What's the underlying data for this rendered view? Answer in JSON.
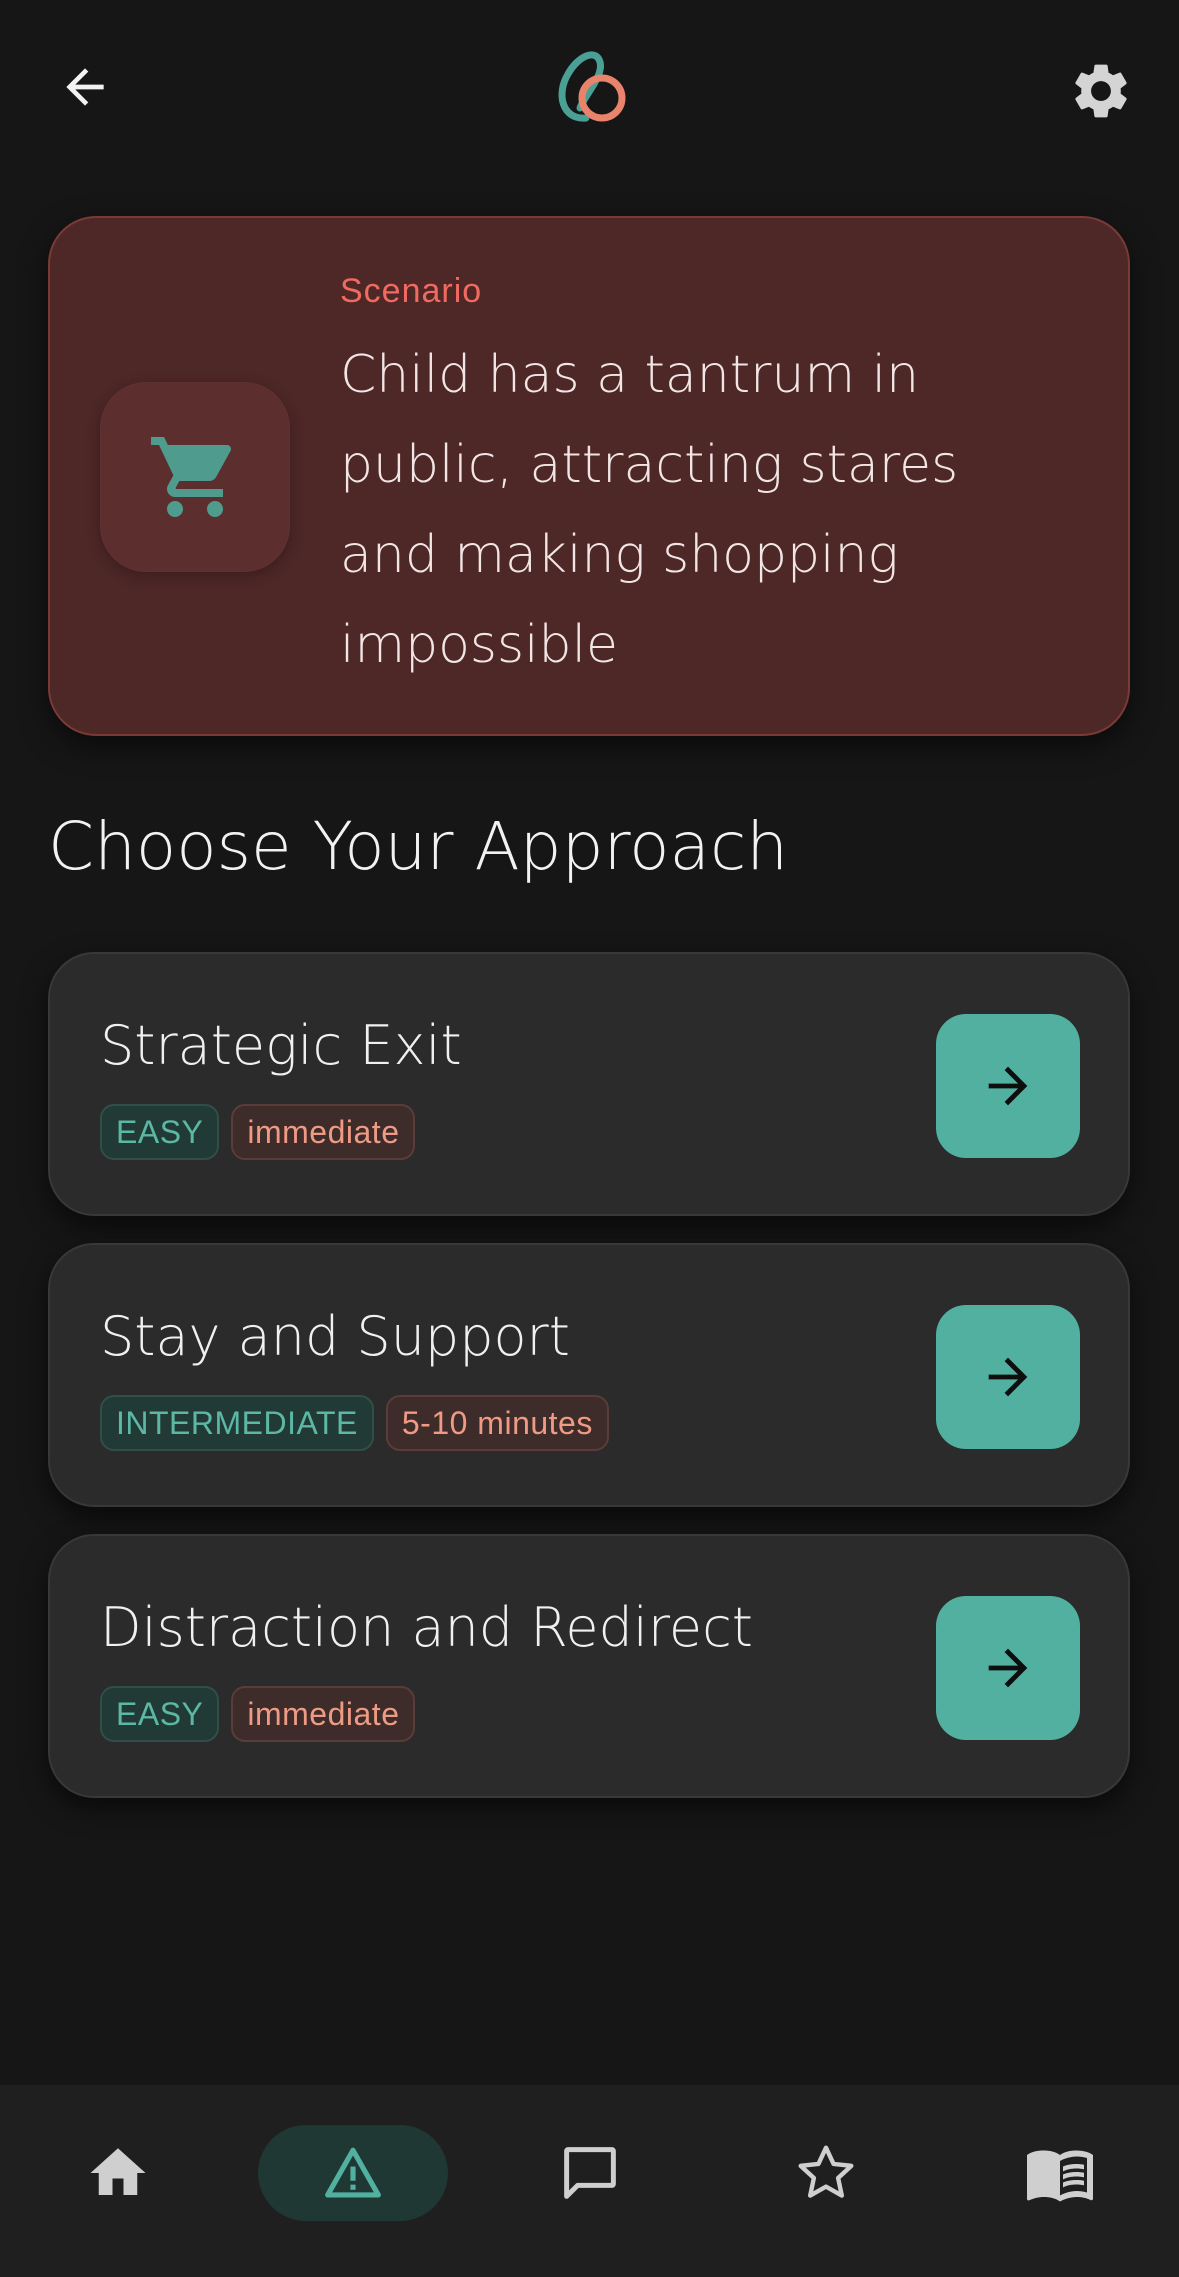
{
  "header": {
    "back_icon": "arrow-left-icon",
    "logo_icon": "app-logo",
    "settings_icon": "gear-icon"
  },
  "scenario": {
    "label": "Scenario",
    "text": "Child has a tantrum in public, attracting stares and making shopping impossible",
    "icon": "shopping-cart-icon"
  },
  "section_title": "Choose Your Approach",
  "approaches": [
    {
      "title": "Strategic Exit",
      "level": "EASY",
      "time": "immediate"
    },
    {
      "title": "Stay and Support",
      "level": "INTERMEDIATE",
      "time": "5-10 minutes"
    },
    {
      "title": "Distraction and Redirect",
      "level": "EASY",
      "time": "immediate"
    }
  ],
  "bottom_nav": {
    "items": [
      "home-icon",
      "warning-icon",
      "chat-icon",
      "star-icon",
      "book-icon"
    ],
    "active": "warning-icon"
  },
  "colors": {
    "background": "#161616",
    "scenario_card": "#4e2727",
    "accent_red": "#ef6a60",
    "accent_teal": "#52b0a0",
    "card": "#2b2b2b",
    "nav_bar": "#1f1f1f"
  }
}
